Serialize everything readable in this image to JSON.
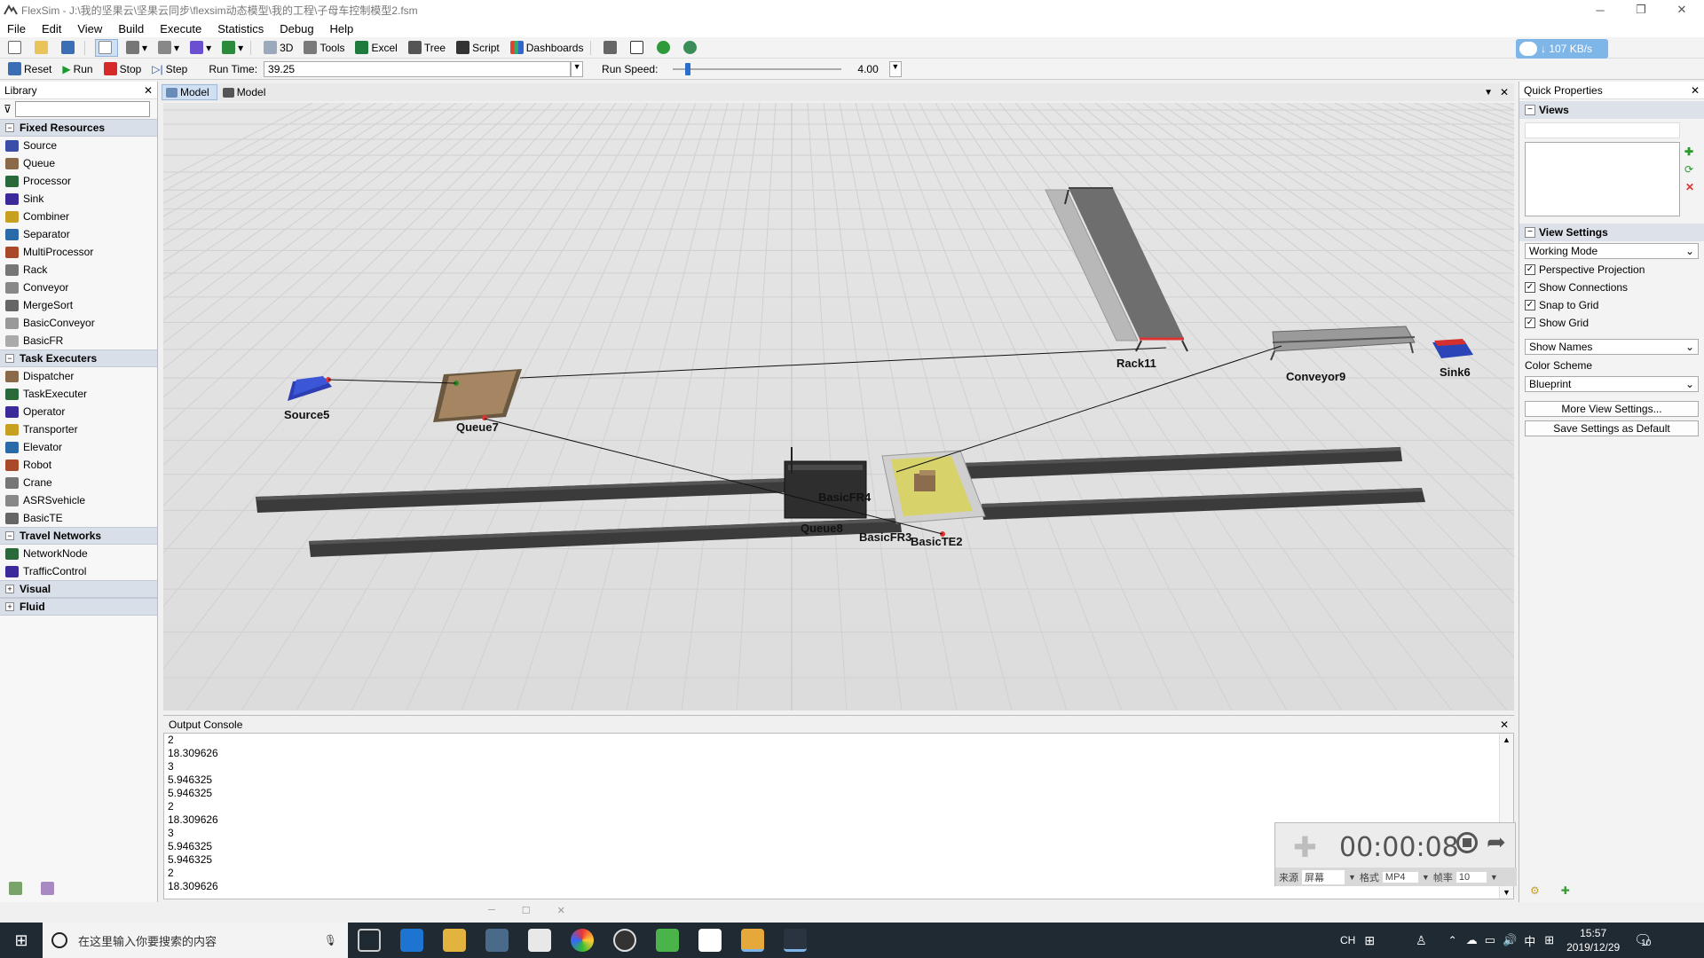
{
  "window": {
    "title": "FlexSim - J:\\我的坚果云\\坚果云同步\\flexsim动态模型\\我的工程\\子母车控制模型2.fsm",
    "minimize": "─",
    "maximize": "❐",
    "close": "✕"
  },
  "menu": [
    "File",
    "Edit",
    "View",
    "Build",
    "Execute",
    "Statistics",
    "Debug",
    "Help"
  ],
  "toolbar": {
    "btn_3d": "3D",
    "btn_tools": "Tools",
    "btn_excel": "Excel",
    "btn_tree": "Tree",
    "btn_script": "Script",
    "btn_dashboards": "Dashboards",
    "net_speed": "↓ 107 KB/s"
  },
  "runbar": {
    "reset": "Reset",
    "run": "Run",
    "stop": "Stop",
    "step": "Step",
    "run_time_label": "Run Time:",
    "run_time_value": "39.25",
    "run_speed_label": "Run Speed:",
    "run_speed_value": "4.00"
  },
  "library": {
    "title": "Library",
    "close": "✕",
    "filter_placeholder": "",
    "categories": [
      {
        "name": "Fixed Resources",
        "expanded": true,
        "items": [
          "Source",
          "Queue",
          "Processor",
          "Sink",
          "Combiner",
          "Separator",
          "MultiProcessor",
          "Rack",
          "Conveyor",
          "MergeSort",
          "BasicConveyor",
          "BasicFR"
        ]
      },
      {
        "name": "Task Executers",
        "expanded": true,
        "items": [
          "Dispatcher",
          "TaskExecuter",
          "Operator",
          "Transporter",
          "Elevator",
          "Robot",
          "Crane",
          "ASRSvehicle",
          "BasicTE"
        ]
      },
      {
        "name": "Travel Networks",
        "expanded": true,
        "items": [
          "NetworkNode",
          "TrafficControl"
        ]
      },
      {
        "name": "Visual",
        "expanded": false,
        "items": []
      },
      {
        "name": "Fluid",
        "expanded": false,
        "items": []
      }
    ]
  },
  "model_tabs": [
    "Model",
    "Model"
  ],
  "viewport": {
    "labels": [
      "Rack11",
      "Conveyor9",
      "Sink6",
      "Source5",
      "Queue7",
      "BasicFR4",
      "Queue8",
      "BasicFR3",
      "BasicTE2"
    ]
  },
  "quick_properties": {
    "title": "Quick Properties",
    "views_section": "Views",
    "view_settings_section": "View Settings",
    "working_mode": "Working Mode",
    "checkboxes": [
      {
        "label": "Perspective Projection",
        "checked": true
      },
      {
        "label": "Show Connections",
        "checked": true
      },
      {
        "label": "Snap to Grid",
        "checked": true
      },
      {
        "label": "Show Grid",
        "checked": true
      }
    ],
    "show_names": "Show Names",
    "color_scheme_label": "Color Scheme",
    "color_scheme_value": "Blueprint",
    "more_settings": "More View Settings...",
    "save_default": "Save Settings as Default"
  },
  "console": {
    "title": "Output Console",
    "lines": [
      "2",
      "18.309626",
      "3",
      "5.946325",
      "5.946325",
      "2",
      "18.309626",
      "3",
      "5.946325",
      "5.946325",
      "2",
      "18.309626"
    ]
  },
  "recorder": {
    "time": "00:00:08",
    "source_label": "来源",
    "source_value": "屏幕",
    "format_label": "格式",
    "format_value": "MP4",
    "fps_label": "帧率",
    "fps_value": "10"
  },
  "taskbar": {
    "search_placeholder": "在这里输入你要搜索的内容",
    "ime": "CH",
    "ime2": "中",
    "time": "15:57",
    "date": "2019/12/29",
    "notif_count": "10"
  }
}
